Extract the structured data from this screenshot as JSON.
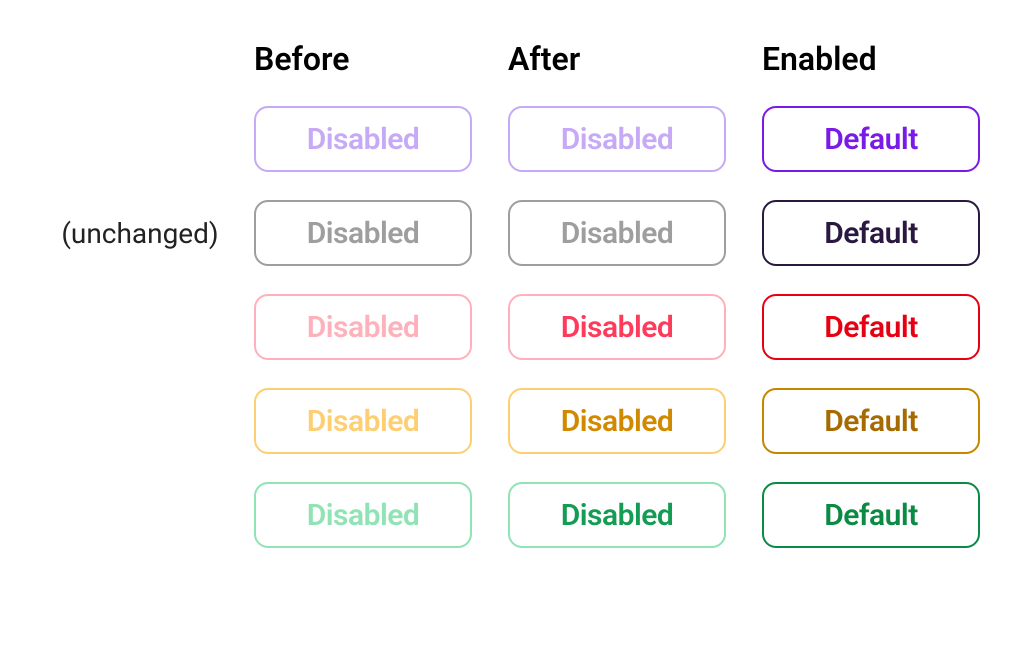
{
  "headers": {
    "before": "Before",
    "after": "After",
    "enabled": "Enabled"
  },
  "disabledLabel": "Disabled",
  "defaultLabel": "Default",
  "unchangedNote": "(unchanged)",
  "rows": [
    {
      "id": "purple",
      "before": {
        "text": "#C6AAF6",
        "border": "#C6AAF6"
      },
      "after": {
        "text": "#C6AAF6",
        "border": "#C6AAF6"
      },
      "enabled": {
        "text": "#7A1AE6",
        "border": "#7A1AE6"
      }
    },
    {
      "id": "gray",
      "note": true,
      "before": {
        "text": "#9E9E9E",
        "border": "#9E9E9E"
      },
      "after": {
        "text": "#9E9E9E",
        "border": "#9E9E9E"
      },
      "enabled": {
        "text": "#2B1840",
        "border": "#2B1840"
      }
    },
    {
      "id": "red",
      "before": {
        "text": "#FFB1BB",
        "border": "#FFB1BB"
      },
      "after": {
        "text": "#FF3B5C",
        "border": "#FFB1BB"
      },
      "enabled": {
        "text": "#E60012",
        "border": "#E60012"
      }
    },
    {
      "id": "orange",
      "before": {
        "text": "#FDCF72",
        "border": "#FDCF72"
      },
      "after": {
        "text": "#D18A00",
        "border": "#FDCF72"
      },
      "enabled": {
        "text": "#A66A00",
        "border": "#C58600"
      }
    },
    {
      "id": "green",
      "before": {
        "text": "#8FE3B4",
        "border": "#8FE3B4"
      },
      "after": {
        "text": "#149C54",
        "border": "#8FE3B4"
      },
      "enabled": {
        "text": "#0B8A44",
        "border": "#0B8A44"
      }
    }
  ]
}
